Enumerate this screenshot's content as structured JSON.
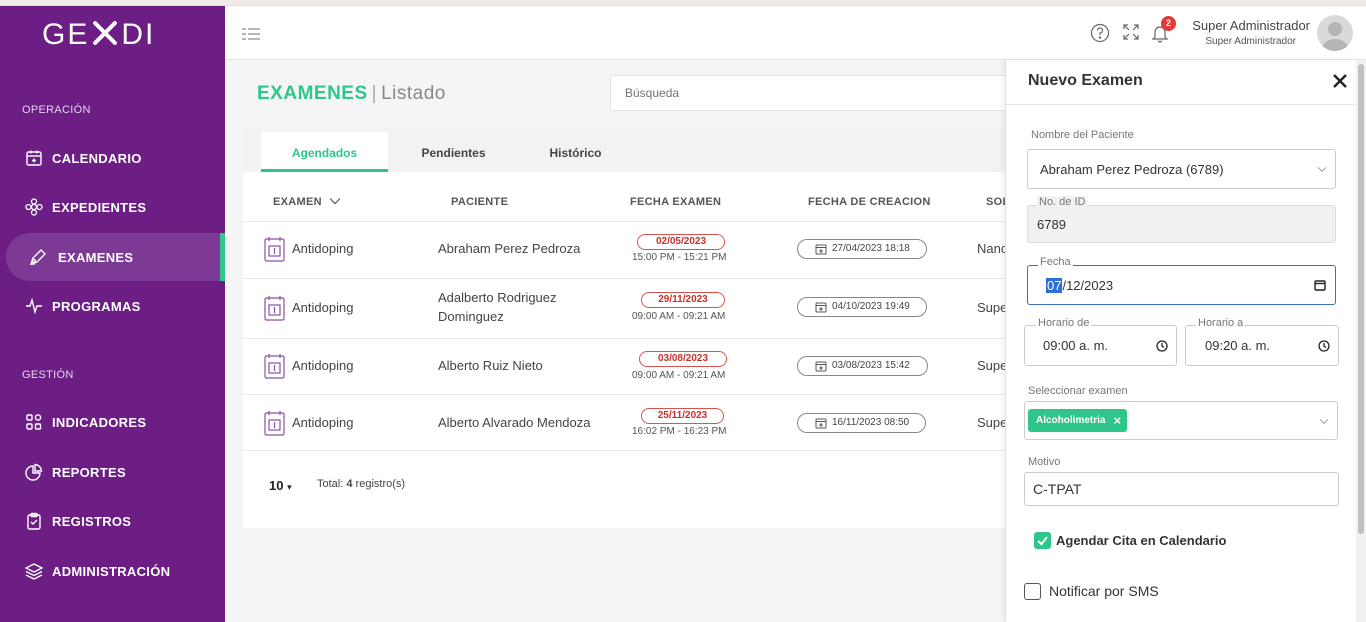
{
  "app": {
    "logo_left": "GE",
    "logo_right": "DI"
  },
  "sidebar": {
    "sections": [
      {
        "label": "OPERACIÓN"
      },
      {
        "label": "GESTIÓN"
      }
    ],
    "items": [
      {
        "label": "CALENDARIO",
        "icon": "calendar-icon"
      },
      {
        "label": "EXPEDIENTES",
        "icon": "flower-icon"
      },
      {
        "label": "EXAMENES",
        "icon": "pen-tool-icon",
        "active": true
      },
      {
        "label": "PROGRAMAS",
        "icon": "activity-icon"
      },
      {
        "label": "INDICADORES",
        "icon": "grid-icon"
      },
      {
        "label": "REPORTES",
        "icon": "pie-chart-icon"
      },
      {
        "label": "REGISTROS",
        "icon": "clipboard-check-icon"
      },
      {
        "label": "ADMINISTRACIÓN",
        "icon": "layers-icon"
      }
    ]
  },
  "header": {
    "notifications_count": "2",
    "user_name": "Super Administrador",
    "user_role": "Super Administrador"
  },
  "page": {
    "title": "EXAMENES",
    "separator": "|",
    "subtitle": "Listado",
    "search_placeholder": "Búsqueda"
  },
  "tabs": [
    {
      "label": "Agendados",
      "active": true
    },
    {
      "label": "Pendientes"
    },
    {
      "label": "Histórico"
    }
  ],
  "table": {
    "columns": [
      "EXAMEN",
      "PACIENTE",
      "FECHA EXAMEN",
      "FECHA DE CREACION",
      "SOL"
    ],
    "rows": [
      {
        "examen": "Antidoping",
        "paciente": "Abraham Perez Pedroza",
        "paciente2": "",
        "fecha": "02/05/2023",
        "horario": "15:00 PM - 15:21 PM",
        "creacion": "27/04/2023 18:18",
        "sol": "Nanc"
      },
      {
        "examen": "Antidoping",
        "paciente": "Adalberto Rodriguez",
        "paciente2": "Dominguez",
        "fecha": "29/11/2023",
        "horario": "09:00 AM - 09:21 AM",
        "creacion": "04/10/2023 19:49",
        "sol": "Supe"
      },
      {
        "examen": "Antidoping",
        "paciente": "Alberto Ruiz Nieto",
        "paciente2": "",
        "fecha": "03/08/2023",
        "horario": "09:00 AM - 09:21 AM",
        "creacion": "03/08/2023 15:42",
        "sol": "Supe"
      },
      {
        "examen": "Antidoping",
        "paciente": "Alberto Alvarado Mendoza",
        "paciente2": "",
        "fecha": "25/11/2023",
        "horario": "16:02 PM - 16:23 PM",
        "creacion": "16/11/2023 08:50",
        "sol": "Supe"
      }
    ],
    "page_size": "10",
    "total_prefix": "Total:",
    "total_count": "4",
    "total_suffix": "registro(s)"
  },
  "panel": {
    "title": "Nuevo Examen",
    "paciente_label": "Nombre del Paciente",
    "paciente_value": "Abraham Perez Pedroza (6789)",
    "id_label": "No. de ID",
    "id_value": "6789",
    "fecha_label": "Fecha",
    "fecha_month": "07",
    "fecha_rest": "/12/2023",
    "horario_de_label": "Horario de",
    "horario_de_value": "09:00 a. m.",
    "horario_a_label": "Horario a",
    "horario_a_value": "09:20 a. m.",
    "examen_label": "Seleccionar examen",
    "examen_chip": "Alcoholimetria",
    "motivo_label": "Motivo",
    "motivo_value": "C-TPAT",
    "agendar_label": "Agendar Cita en Calendario",
    "agendar_checked": true,
    "sms_label": "Notificar por SMS",
    "sms_checked": false
  },
  "colors": {
    "sidebar": "#6c1e84",
    "accent": "#2ec68b",
    "danger": "#d9534f"
  }
}
